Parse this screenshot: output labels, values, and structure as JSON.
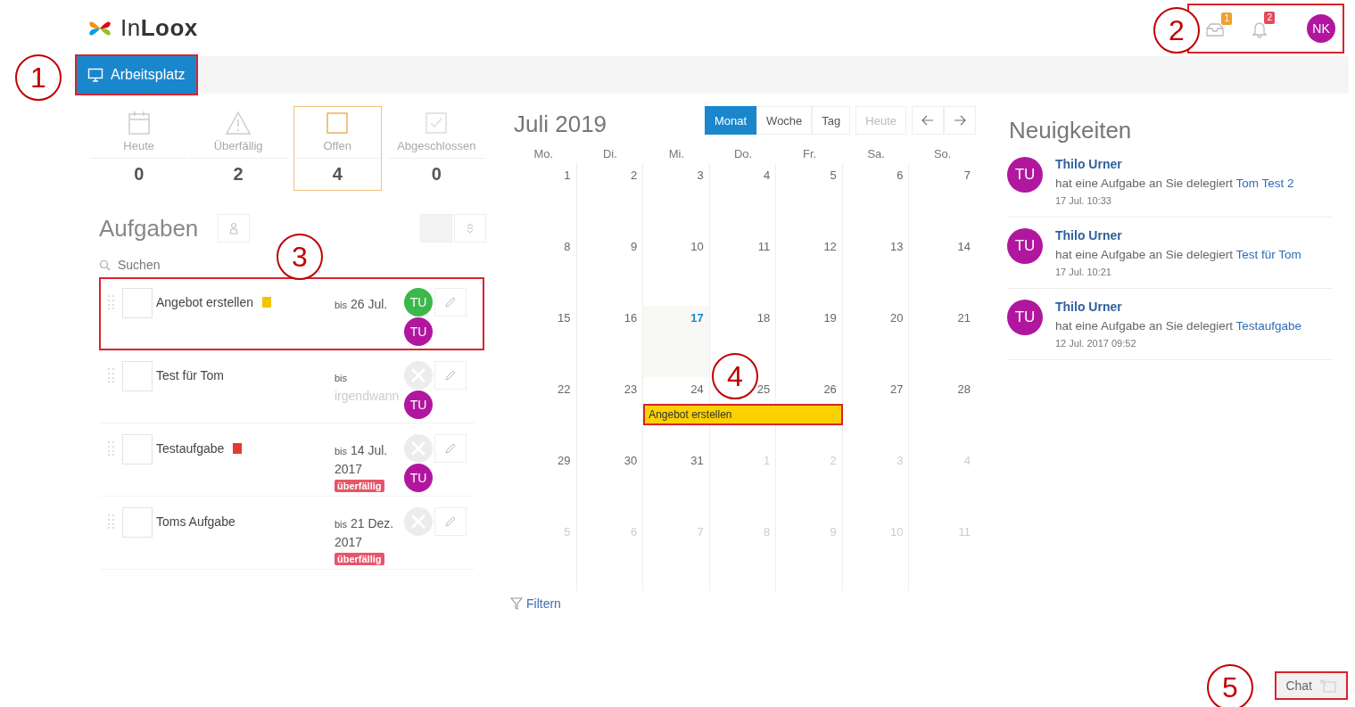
{
  "header": {
    "logo": "In**Loox**",
    "inbox": {
      "badge": "1"
    },
    "notifications": {
      "badge": "2"
    },
    "user": {
      "initials": "NK"
    },
    "highlighted": true
  },
  "nav": {
    "tabs": [
      {
        "label": "Arbeitsplatz",
        "selected": true,
        "highlighted": true
      }
    ]
  },
  "stats": [
    {
      "kind": "calendar",
      "label": "Heute",
      "count": "0",
      "selected": false
    },
    {
      "kind": "warning",
      "label": "Überfällig",
      "count": "2",
      "selected": false
    },
    {
      "kind": "open",
      "label": "Offen",
      "count": "4",
      "selected": true
    },
    {
      "kind": "done",
      "label": "Abgeschlossen",
      "count": "0",
      "selected": false
    }
  ],
  "tasks": {
    "title": "Aufgaben",
    "search": {
      "placeholder": "Suchen"
    },
    "items": [
      {
        "name": "Angebot erstellen",
        "color": "#f5c400",
        "due_prefix": "bis",
        "due": "26 Jul.",
        "due_unset": false,
        "owner": {
          "initials": "TU",
          "color": "#3cb84a"
        },
        "assignee": {
          "initials": "TU",
          "color": "#b0179e"
        },
        "highlighted": true
      },
      {
        "name": "Test für Tom",
        "due_prefix": "bis",
        "due": "irgendwann",
        "due_unset": true,
        "assignee": {
          "initials": "TU",
          "color": "#b0179e"
        },
        "highlighted": false
      },
      {
        "name": "Testaufgabe",
        "color": "#e53935",
        "due_prefix": "bis",
        "due": "14 Jul. 2017",
        "due_unset": false,
        "overdue": "überfällig",
        "assignee": {
          "initials": "TU",
          "color": "#b0179e"
        },
        "highlighted": false
      },
      {
        "name": "Toms Aufgabe",
        "due_prefix": "bis",
        "due": "21 Dez. 2017",
        "due_unset": false,
        "overdue": "überfällig",
        "highlighted": false
      }
    ]
  },
  "calendar": {
    "title": "Juli 2019",
    "views": [
      {
        "label": "Monat",
        "selected": true
      },
      {
        "label": "Woche",
        "selected": false
      },
      {
        "label": "Tag",
        "selected": false
      }
    ],
    "today_button": "Heute",
    "weekdays": [
      "Mo.",
      "Di.",
      "Mi.",
      "Do.",
      "Fr.",
      "Sa.",
      "So."
    ],
    "weeks": [
      {
        "days": [
          {
            "day": "1",
            "other_month": false,
            "today": false
          },
          {
            "day": "2",
            "other_month": false,
            "today": false
          },
          {
            "day": "3",
            "other_month": false,
            "today": false
          },
          {
            "day": "4",
            "other_month": false,
            "today": false
          },
          {
            "day": "5",
            "other_month": false,
            "today": false
          },
          {
            "day": "6",
            "other_month": false,
            "today": false
          },
          {
            "day": "7",
            "other_month": false,
            "today": false
          }
        ]
      },
      {
        "days": [
          {
            "day": "8",
            "other_month": false,
            "today": false
          },
          {
            "day": "9",
            "other_month": false,
            "today": false
          },
          {
            "day": "10",
            "other_month": false,
            "today": false
          },
          {
            "day": "11",
            "other_month": false,
            "today": false
          },
          {
            "day": "12",
            "other_month": false,
            "today": false
          },
          {
            "day": "13",
            "other_month": false,
            "today": false
          },
          {
            "day": "14",
            "other_month": false,
            "today": false
          }
        ]
      },
      {
        "days": [
          {
            "day": "15",
            "other_month": false,
            "today": false
          },
          {
            "day": "16",
            "other_month": false,
            "today": false
          },
          {
            "day": "17",
            "other_month": false,
            "today": true
          },
          {
            "day": "18",
            "other_month": false,
            "today": false
          },
          {
            "day": "19",
            "other_month": false,
            "today": false
          },
          {
            "day": "20",
            "other_month": false,
            "today": false
          },
          {
            "day": "21",
            "other_month": false,
            "today": false
          }
        ]
      },
      {
        "days": [
          {
            "day": "22",
            "other_month": false,
            "today": false,
            "in_event": false
          },
          {
            "day": "23",
            "other_month": false,
            "today": false,
            "in_event": false
          },
          {
            "day": "24",
            "other_month": false,
            "today": false,
            "in_event": true
          },
          {
            "day": "25",
            "other_month": false,
            "today": false,
            "in_event": true
          },
          {
            "day": "26",
            "other_month": false,
            "today": false,
            "in_event": true
          },
          {
            "day": "27",
            "other_month": false,
            "today": false,
            "in_event": false
          },
          {
            "day": "28",
            "other_month": false,
            "today": false,
            "in_event": false
          }
        ],
        "events": [
          {
            "title": "Angebot erstellen",
            "color": "#fcd100",
            "highlighted": true
          }
        ]
      },
      {
        "days": [
          {
            "day": "29",
            "other_month": false,
            "today": false
          },
          {
            "day": "30",
            "other_month": false,
            "today": false
          },
          {
            "day": "31",
            "other_month": false,
            "today": false
          },
          {
            "day": "1",
            "other_month": true,
            "today": false
          },
          {
            "day": "2",
            "other_month": true,
            "today": false
          },
          {
            "day": "3",
            "other_month": true,
            "today": false
          },
          {
            "day": "4",
            "other_month": true,
            "today": false
          }
        ]
      },
      {
        "days": [
          {
            "day": "5",
            "other_month": true,
            "today": false
          },
          {
            "day": "6",
            "other_month": true,
            "today": false
          },
          {
            "day": "7",
            "other_month": true,
            "today": false
          },
          {
            "day": "8",
            "other_month": true,
            "today": false
          },
          {
            "day": "9",
            "other_month": true,
            "today": false
          },
          {
            "day": "10",
            "other_month": true,
            "today": false
          },
          {
            "day": "11",
            "other_month": true,
            "today": false
          }
        ]
      }
    ],
    "filter": "Filtern"
  },
  "news": {
    "title": "Neuigkeiten",
    "items": [
      {
        "initials": "TU",
        "author": "Thilo Urner",
        "text": "hat eine Aufgabe an Sie delegiert",
        "link": "Tom Test 2",
        "time": "17 Jul. 10:33"
      },
      {
        "initials": "TU",
        "author": "Thilo Urner",
        "text": "hat eine Aufgabe an Sie delegiert",
        "link": "Test für Tom",
        "time": "17 Jul. 10:21"
      },
      {
        "initials": "TU",
        "author": "Thilo Urner",
        "text": "hat eine Aufgabe an Sie delegiert",
        "link": "Testaufgabe",
        "time": "12 Jul. 2017 09:52"
      }
    ]
  },
  "chat": {
    "label": "Chat",
    "highlighted": true
  },
  "callouts": [
    "1",
    "2",
    "3",
    "4",
    "5"
  ]
}
